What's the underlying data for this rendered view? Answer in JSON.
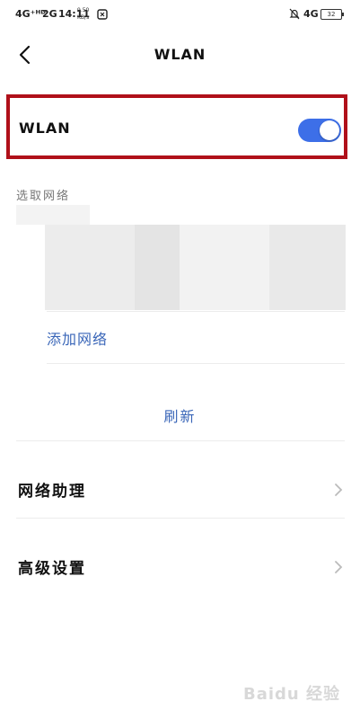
{
  "status_bar": {
    "net1": "4G⁺ᴴᴰ",
    "net2": "2G",
    "time": "14:11",
    "speed_value": "9.50",
    "speed_unit": "KB/s",
    "net3": "4G",
    "battery": "32"
  },
  "header": {
    "title": "WLAN"
  },
  "wlan": {
    "label": "WLAN",
    "enabled": true,
    "toggle_color": "#3d6fe8",
    "highlight_color": "#b0101a"
  },
  "networks": {
    "section_label": "选取网络",
    "add_network_label": "添加网络",
    "refresh_label": "刷新"
  },
  "menu": {
    "items": [
      {
        "label": "网络助理"
      },
      {
        "label": "高级设置"
      }
    ]
  },
  "watermark": "Baidu 经验"
}
